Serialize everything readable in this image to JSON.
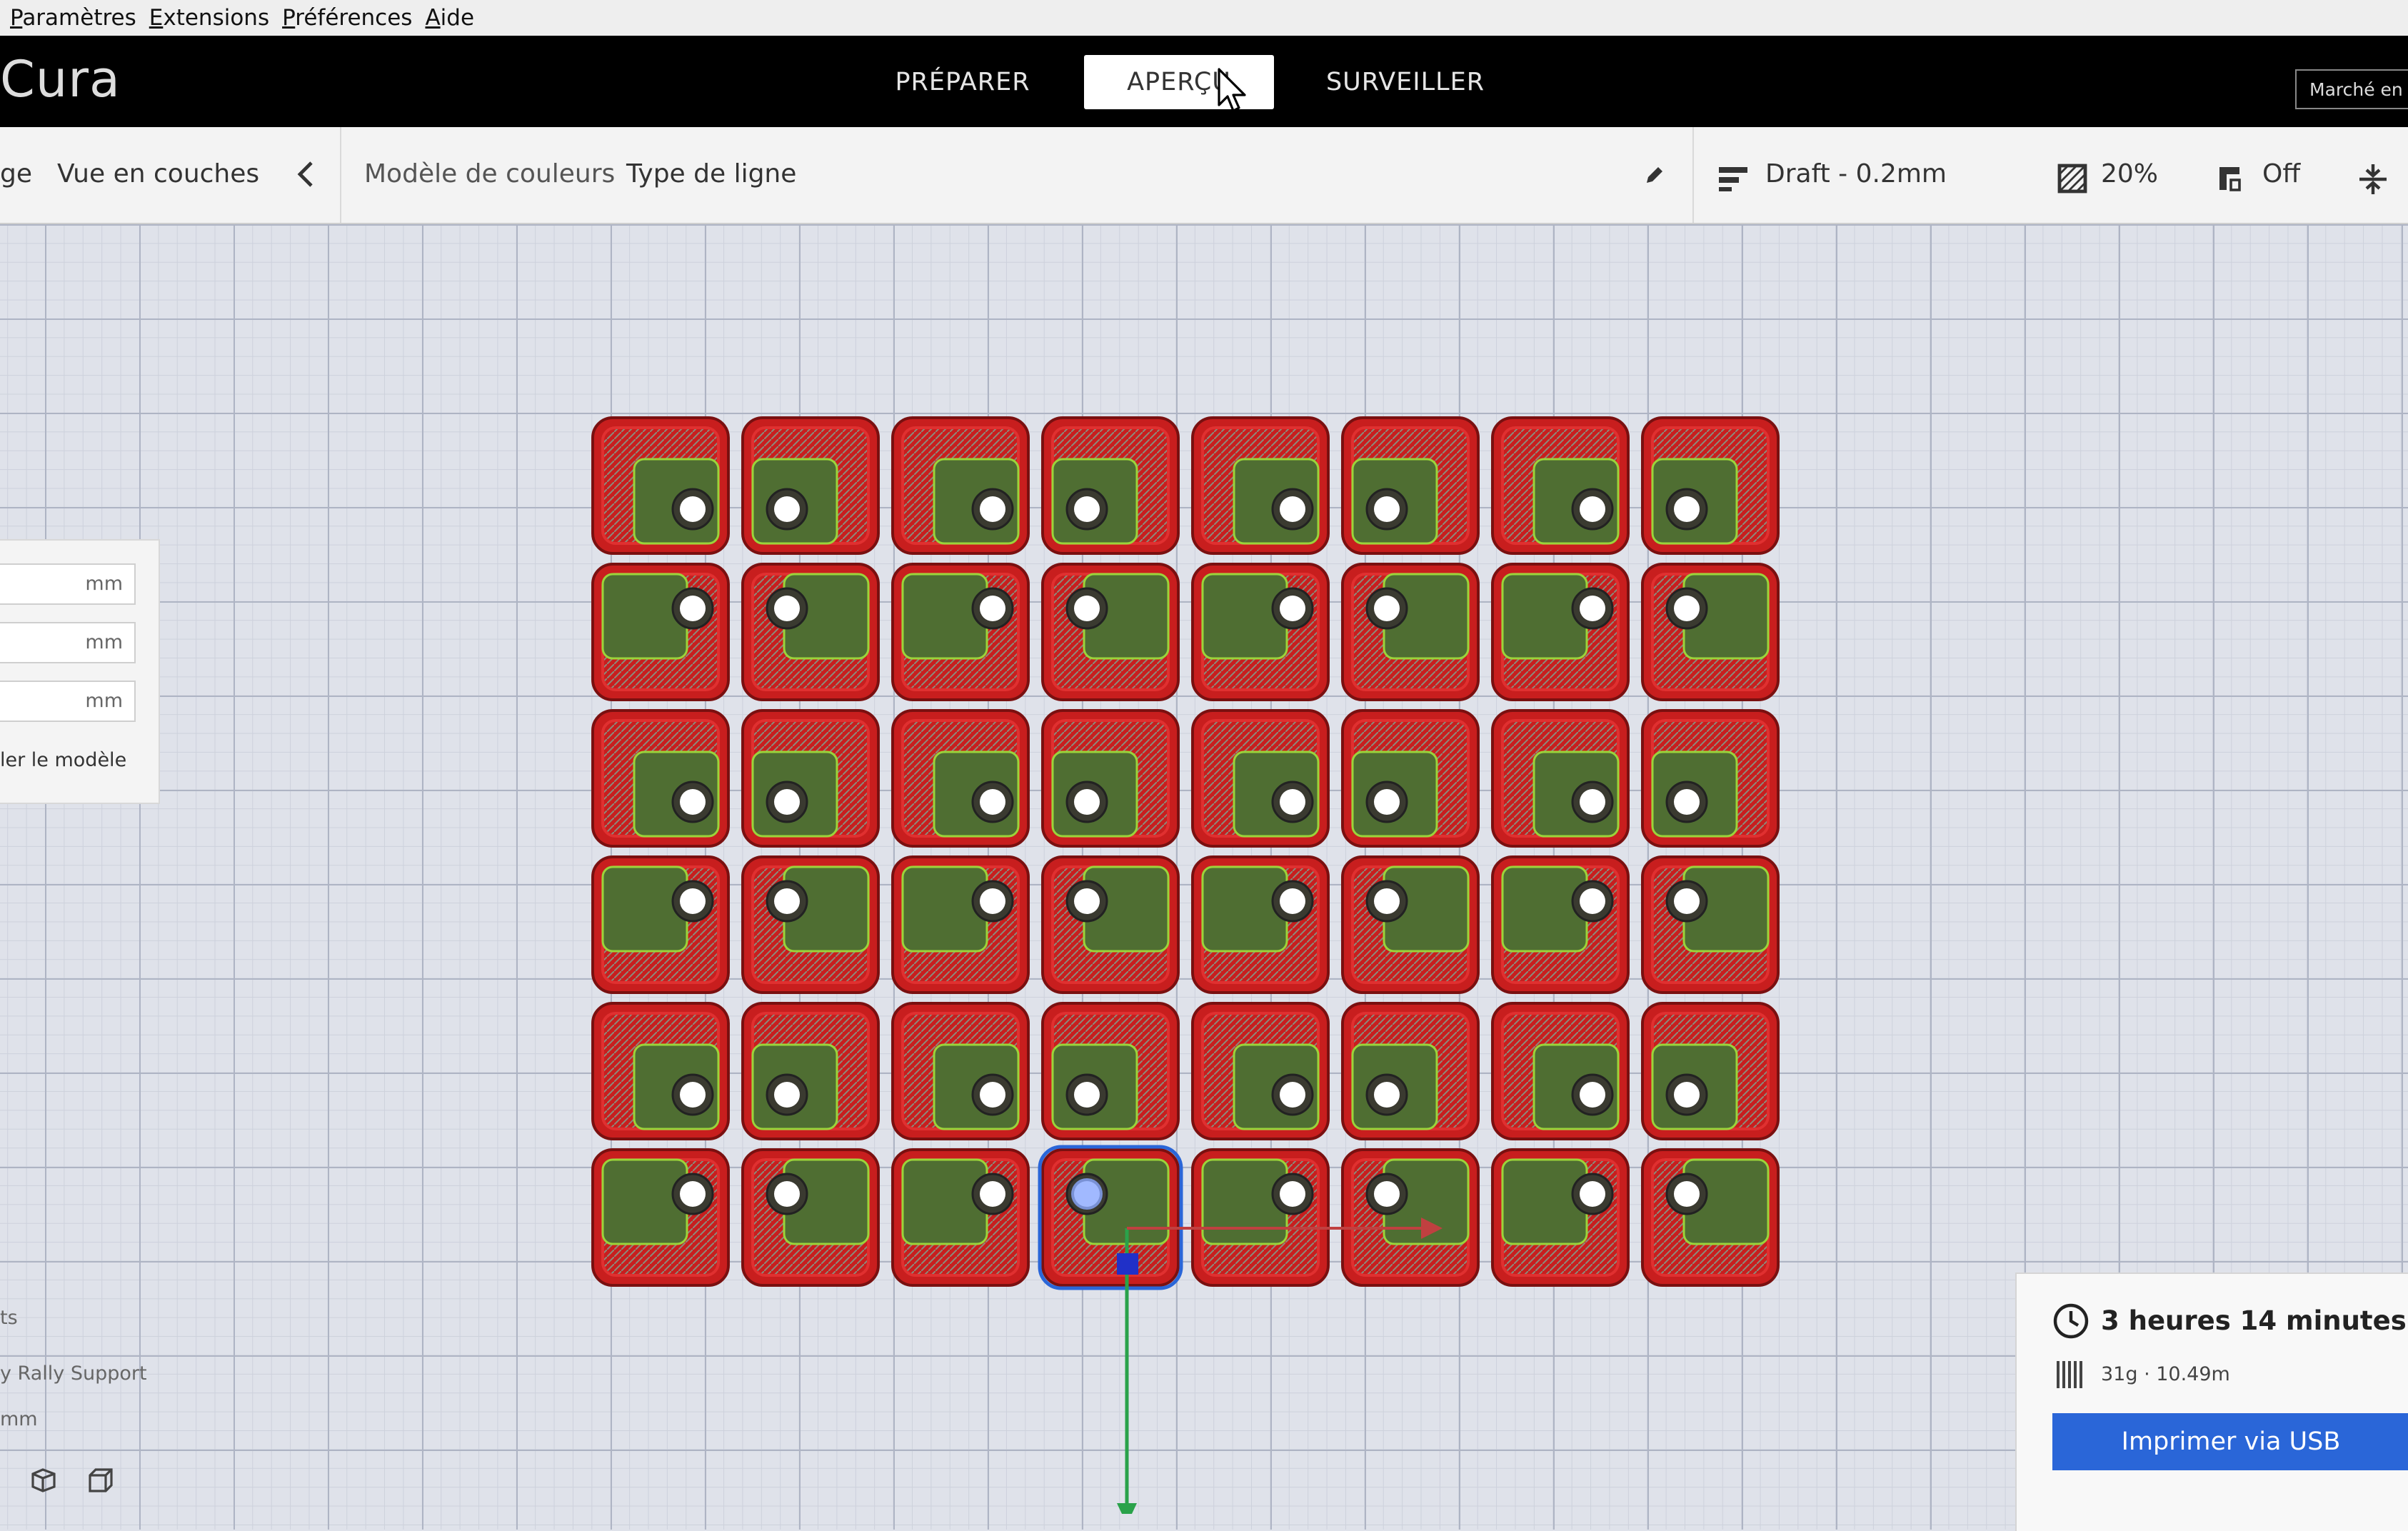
{
  "menu": [
    "Paramètres",
    "Extensions",
    "Préférences",
    "Aide"
  ],
  "app_title": "Cura",
  "stages": {
    "prepare": "PRÉPARER",
    "preview": "APERÇU",
    "monitor": "SURVEILLER",
    "active": "preview"
  },
  "marketplace": "Marché en",
  "view": {
    "left_fragment": "ge",
    "view_type": "Vue en couches",
    "color_scheme_label": "Modèle de couleurs",
    "color_scheme_value": "Type de ligne"
  },
  "print_settings": {
    "profile": "Draft - 0.2mm",
    "infill": "20%",
    "support": "Off"
  },
  "side_panel": {
    "fields": [
      {
        "unit": "mm"
      },
      {
        "unit": "mm"
      },
      {
        "unit": "mm"
      }
    ],
    "scale_label": "ler le modèle"
  },
  "left_texts": {
    "line1": "ts",
    "line2": "y Rally Support",
    "line3": "mm"
  },
  "plate": {
    "rows": 6,
    "cols": 8,
    "selected": {
      "row": 6,
      "col": 4
    }
  },
  "colors": {
    "wall_outer": "#c81e1e",
    "wall_inner": "#e03030",
    "infill": "#4f6e32",
    "skin": "#707060",
    "accent": "#2a66d8"
  },
  "info": {
    "print_time": "3 heures 14 minutes",
    "material": "31g · 10.49m",
    "print_button": "Imprimer via USB"
  }
}
